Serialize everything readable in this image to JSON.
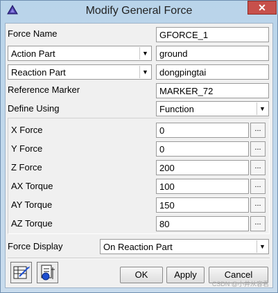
{
  "window": {
    "title": "Modify General Force",
    "close_glyph": "✕"
  },
  "form": {
    "force_name_label": "Force Name",
    "force_name_value": "GFORCE_1",
    "action_part_label": "Action Part",
    "action_part_value": "ground",
    "reaction_part_label": "Reaction Part",
    "reaction_part_value": "dongpingtai",
    "reference_marker_label": "Reference Marker",
    "reference_marker_value": "MARKER_72",
    "define_using_label": "Define Using",
    "define_using_value": "Function"
  },
  "components": [
    {
      "label": "X Force",
      "value": "0"
    },
    {
      "label": "Y Force",
      "value": "0"
    },
    {
      "label": "Z Force",
      "value": "200"
    },
    {
      "label": "AX Torque",
      "value": "100"
    },
    {
      "label": "AY Torque",
      "value": "150"
    },
    {
      "label": "AZ Torque",
      "value": "80"
    }
  ],
  "ellipsis": "...",
  "display": {
    "label": "Force Display",
    "value": "On Reaction Part"
  },
  "buttons": {
    "ok": "OK",
    "apply": "Apply",
    "cancel": "Cancel"
  },
  "watermark": "CSDN @小井从容君",
  "icons": {
    "system": "triangle-icon",
    "edit": "edit-table-icon",
    "plot": "plot-icon"
  },
  "colors": {
    "close": "#c7504b",
    "title_bg": "#b9d4ea"
  }
}
